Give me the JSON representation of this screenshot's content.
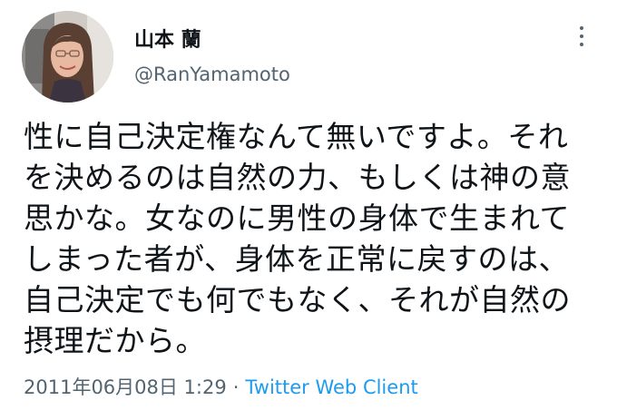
{
  "author": {
    "display_name": "山本 蘭",
    "username": "@RanYamamoto"
  },
  "tweet": {
    "lines": [
      "性に自己決定権なんて無いですよ。それ",
      "を決めるのは自然の力、もしくは神の意",
      "思かな。女なのに男性の身体で生まれて",
      "しまった者が、身体を正常に戻すのは、",
      "自己決定でも何でもなく、それが自然の",
      "摂理だから。"
    ]
  },
  "meta": {
    "timestamp": "2011年06月08日 1:29",
    "separator": "·",
    "client": "Twitter Web Client"
  },
  "icons": {
    "more": "more-vertical-icon"
  },
  "colors": {
    "text": "#0f1419",
    "secondary": "#536471",
    "link": "#1d9bf0"
  }
}
